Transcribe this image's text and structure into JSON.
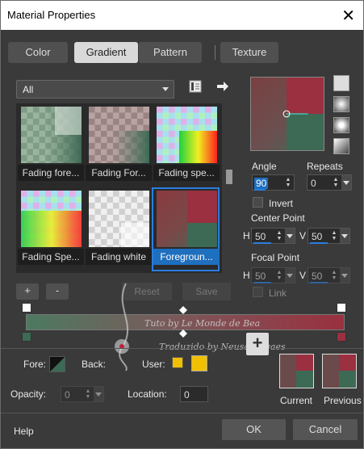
{
  "window": {
    "title": "Material Properties",
    "close_glyph": "✕"
  },
  "tabs": [
    {
      "label": "Color",
      "active": false
    },
    {
      "label": "Gradient",
      "active": true
    },
    {
      "label": "Pattern",
      "active": false
    },
    {
      "label": "Texture",
      "active": false
    }
  ],
  "category": {
    "selected": "All"
  },
  "gallery": [
    {
      "label": "Fading fore...",
      "selected": false
    },
    {
      "label": "Fading For...",
      "selected": false
    },
    {
      "label": "Fading spe...",
      "selected": false
    },
    {
      "label": "Fading Spe...",
      "selected": false
    },
    {
      "label": "Fading white",
      "selected": false
    },
    {
      "label": "Foregroun...",
      "selected": true
    }
  ],
  "buttons": {
    "add": "+",
    "remove": "-",
    "reset": "Reset",
    "save": "Save",
    "ok": "OK",
    "cancel": "Cancel",
    "help": "Help",
    "add_swatch": "+"
  },
  "angle": {
    "label": "Angle",
    "value": "90"
  },
  "repeats": {
    "label": "Repeats",
    "value": "0"
  },
  "invert": {
    "label": "Invert"
  },
  "center_point": {
    "label": "Center Point",
    "h_label": "H",
    "h_value": "50",
    "v_label": "V",
    "v_value": "50"
  },
  "focal_point": {
    "label": "Focal Point",
    "h_label": "H",
    "h_value": "50",
    "v_label": "V",
    "v_value": "50"
  },
  "link": {
    "label": "Link"
  },
  "stops": {
    "fore_label": "Fore:",
    "back_label": "Back:",
    "user_label": "User:",
    "opacity_label": "Opacity:",
    "opacity_value": "0",
    "location_label": "Location:",
    "location_value": "0"
  },
  "swatches": {
    "current_label": "Current",
    "previous_label": "Previous"
  },
  "watermark": {
    "line1": "Tuto by  Le Monde de Bea",
    "line2": "Traduzido by  Neusa Novaes"
  },
  "colors": {
    "fore": "#5a7a65",
    "back": "#9a3040",
    "accent": "#2a7de0",
    "user": "#f0c000"
  }
}
